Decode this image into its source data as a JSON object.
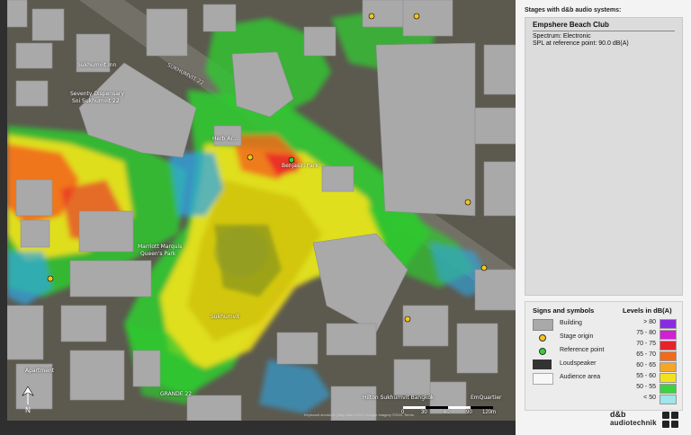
{
  "panel": {
    "header": "Stages with d&b audio systems:",
    "stage": {
      "name": "Empshere Beach Club",
      "spectrum": "Spectrum:  Electronic",
      "spl": "SPL at reference point:  90.0 dB(A)"
    }
  },
  "legend": {
    "signs_title": "Signs and symbols",
    "levels_title": "Levels in dB(A)",
    "signs": [
      {
        "label": "Building",
        "symbol": "grey-rectangle"
      },
      {
        "label": "Stage origin",
        "symbol": "yellow-dot"
      },
      {
        "label": "Reference point",
        "symbol": "green-dot"
      },
      {
        "label": "Loudspeaker",
        "symbol": "dark-rectangle"
      },
      {
        "label": "Audience area",
        "symbol": "outlined-rectangle"
      }
    ],
    "levels": [
      {
        "label": "> 80",
        "color": "#8a2be2"
      },
      {
        "label": "75 - 80",
        "color": "#d21fd2"
      },
      {
        "label": "70 - 75",
        "color": "#e8222a"
      },
      {
        "label": "65 - 70",
        "color": "#f26a1b"
      },
      {
        "label": "60 - 65",
        "color": "#f5a623"
      },
      {
        "label": "55 - 60",
        "color": "#f2e21b"
      },
      {
        "label": "50 - 55",
        "color": "#3fd13f"
      },
      {
        "label": "< 50",
        "color": "#9fe6ea"
      }
    ]
  },
  "map": {
    "labels": {
      "label_a": "Sukhumvit Inn",
      "label_b": "Seventy Dispensary",
      "label_c": "Soi Sukhumvit 22",
      "label_d": "Herb Ar...",
      "label_e": "Benjasiri Park",
      "label_f": "Marriott Marquis",
      "label_g": "Queen's Park",
      "label_h": "Sukhumvit",
      "label_i": "Apartment",
      "label_j": "SUKHUMVIT 22",
      "label_k": "Hilton Sukhumvit Bangkok",
      "label_l": "EmQuartier",
      "label_m": "GRANDE 22"
    },
    "attribution": "Keyboard shortcuts | Map data ©2021 Google Imagery ©2021 Terms",
    "scale_labels": [
      "0",
      "30",
      "60",
      "90",
      "120m"
    ]
  },
  "logo": {
    "line1": "d&b",
    "line2": "audiotechnik"
  }
}
